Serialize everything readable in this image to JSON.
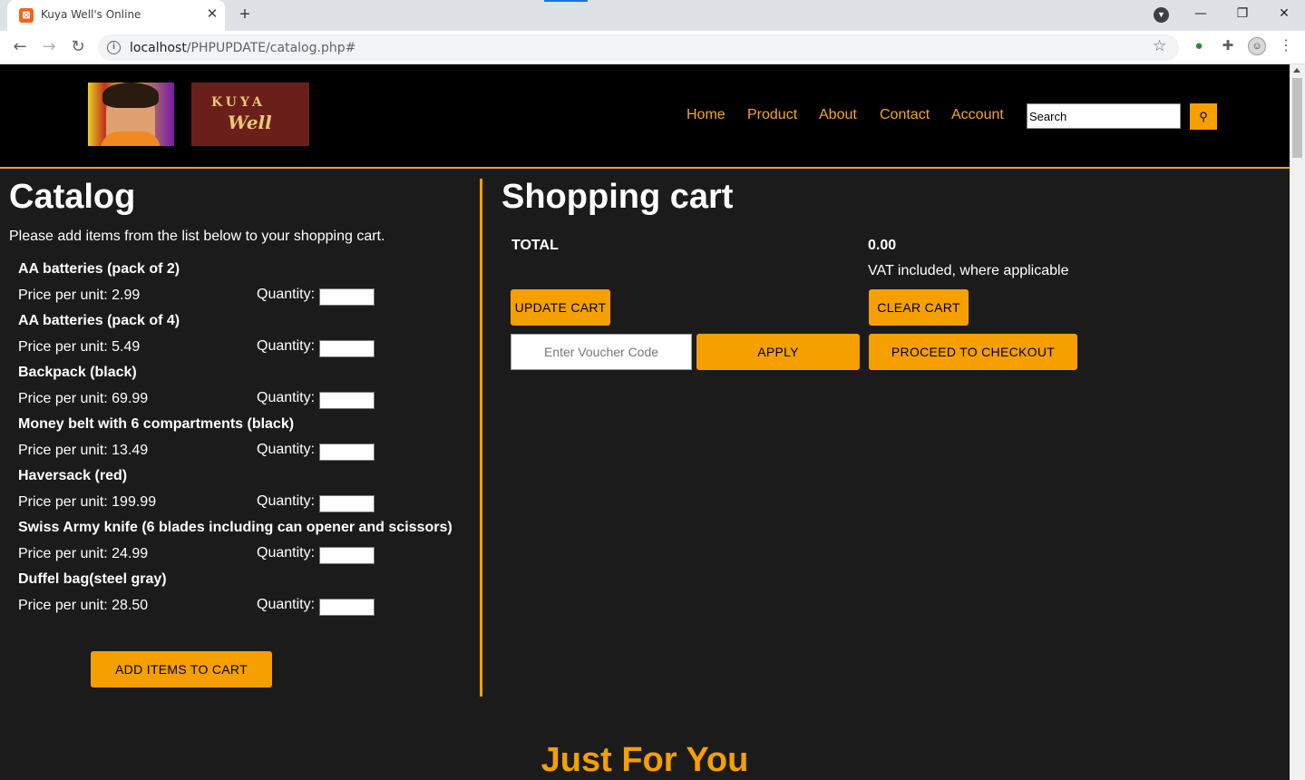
{
  "browser": {
    "tab_title": "Kuya Well's Online",
    "tab_close": "✕",
    "new_tab": "+",
    "url_host": "localhost",
    "url_path": "/PHPUPDATE/catalog.php#",
    "icons": [
      "favicon-icon",
      "info-icon",
      "star-icon",
      "extension-globe-icon",
      "puzzle-icon",
      "profile-avatar",
      "menu-dots-icon"
    ]
  },
  "window_controls": {
    "minimize": "—",
    "maximize": "❐",
    "close": "✕"
  },
  "header": {
    "logo_line1": "KUYA",
    "logo_line2": "Well",
    "nav": [
      "Home",
      "Product",
      "About",
      "Contact",
      "Account"
    ],
    "search_placeholder": "Search",
    "search_button_icon": "search-icon",
    "accent_color": "#f5a000"
  },
  "catalog": {
    "title": "Catalog",
    "intro": "Please add items from the list below to your shopping cart.",
    "qty_label": "Quantity:",
    "price_prefix": "Price per unit: ",
    "items": [
      {
        "name": "AA batteries (pack of 2)",
        "price": "Price per unit: 2.99"
      },
      {
        "name": "AA batteries (pack of 4)",
        "price": "Price per unit: 5.49"
      },
      {
        "name": "Backpack (black)",
        "price": "Price per unit: 69.99"
      },
      {
        "name": "Money belt with 6 compartments (black)",
        "price": "Price per unit: 13.49"
      },
      {
        "name": "Haversack (red)",
        "price": "Price per unit: 199.99"
      },
      {
        "name": "Swiss Army knife (6 blades including can opener and scissors)",
        "price": "Price per unit: 24.99"
      },
      {
        "name": "Duffel bag(steel gray)",
        "price": "Price per unit: 28.50"
      }
    ],
    "add_button": "ADD ITEMS TO CART"
  },
  "cart": {
    "title": "Shopping cart",
    "total_label": "TOTAL",
    "total_value": "0.00",
    "vat_note": "VAT included, where applicable",
    "update_button": "UPDATE CART",
    "clear_button": "CLEAR CART",
    "voucher_placeholder": "Enter Voucher Code",
    "apply_button": "APPLY",
    "checkout_button": "PROCEED TO CHECKOUT"
  },
  "section": {
    "just_for_you": "Just For You"
  }
}
